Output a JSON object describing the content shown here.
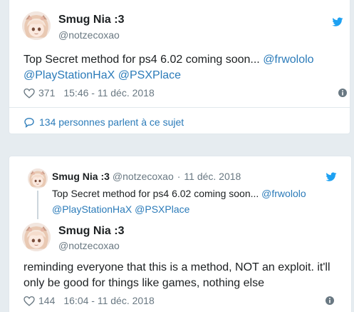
{
  "colors": {
    "background": "#e6ecf0",
    "card": "#ffffff",
    "link": "#2b7bb9",
    "twitter_bird": "#1da1f2",
    "muted": "#697882"
  },
  "tweet1": {
    "author_name": "Smug Nia :3",
    "author_handle": "@notzecoxao",
    "text": "Top Secret method for ps4 6.02 coming soon... ",
    "mentions": [
      "@frwololo",
      "@PlayStationHaX",
      "@PSXPlace"
    ],
    "likes": "371",
    "timestamp": "15:46 - 11 déc. 2018",
    "replies_label": "134 personnes parlent à ce sujet",
    "icons": [
      "twitter-bird-icon",
      "heart-icon",
      "info-icon",
      "comment-icon"
    ]
  },
  "tweet2": {
    "quoted": {
      "author_name": "Smug Nia :3",
      "author_handle": "@notzecoxao",
      "date": "11 déc. 2018",
      "text": "Top Secret method for ps4 6.02 coming soon... ",
      "mentions": [
        "@frwololo",
        "@PlayStationHaX",
        "@PSXPlace"
      ]
    },
    "author_name": "Smug Nia :3",
    "author_handle": "@notzecoxao",
    "text": "reminding everyone that this is a method, NOT an exploit. it'll only be good for things like games, nothing else",
    "likes": "144",
    "timestamp": "16:04 - 11 déc. 2018",
    "icons": [
      "twitter-bird-icon",
      "heart-icon",
      "info-icon"
    ]
  }
}
